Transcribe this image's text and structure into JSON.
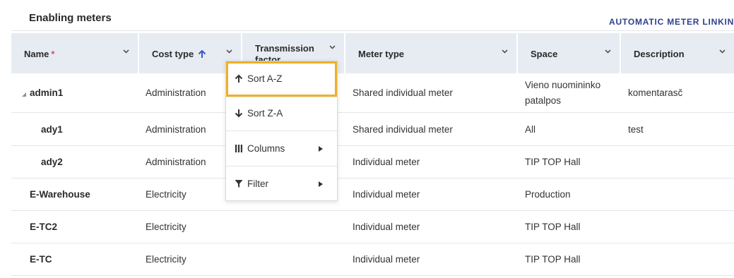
{
  "section": {
    "title": "Enabling meters",
    "action_link": "AUTOMATIC METER LINKIN"
  },
  "columns": [
    {
      "label": "Name",
      "required_mark": "*"
    },
    {
      "label": "Cost type",
      "sort": "ascending"
    },
    {
      "label": "Transmission factor"
    },
    {
      "label": "Meter type"
    },
    {
      "label": "Space"
    },
    {
      "label": "Description"
    }
  ],
  "rows": [
    {
      "name": "admin1",
      "cost_type": "Administration",
      "meter_type": "Shared individual meter",
      "space": "Vieno nuomininko patalpos",
      "description": "komentarasč",
      "expanded": true
    },
    {
      "name": "ady1",
      "cost_type": "Administration",
      "meter_type": "Shared individual meter",
      "space": "All",
      "description": "test"
    },
    {
      "name": "ady2",
      "cost_type": "Administration",
      "meter_type": "Individual meter",
      "space": "TIP TOP Hall",
      "description": ""
    },
    {
      "name": "E-Warehouse",
      "cost_type": "Electricity",
      "meter_type": "Individual meter",
      "space": "Production",
      "description": ""
    },
    {
      "name": "E-TC2",
      "cost_type": "Electricity",
      "meter_type": "Individual meter",
      "space": "TIP TOP Hall",
      "description": ""
    },
    {
      "name": "E-TC",
      "cost_type": "Electricity",
      "meter_type": "Individual meter",
      "space": "TIP TOP Hall",
      "description": ""
    }
  ],
  "column_menu": {
    "items": [
      {
        "label": "Sort A-Z",
        "icon": "arrow-up-icon",
        "highlighted": true
      },
      {
        "label": "Sort Z-A",
        "icon": "arrow-down-icon"
      },
      {
        "label": "Columns",
        "icon": "columns-icon",
        "submenu": true
      },
      {
        "label": "Filter",
        "icon": "filter-icon",
        "submenu": true
      }
    ]
  },
  "colors": {
    "header_bg": "#e7ebf2",
    "accent": "#2e3f8f",
    "sort_icon": "#3b55c4",
    "required": "#d9534f",
    "highlight": "#f0b023"
  }
}
